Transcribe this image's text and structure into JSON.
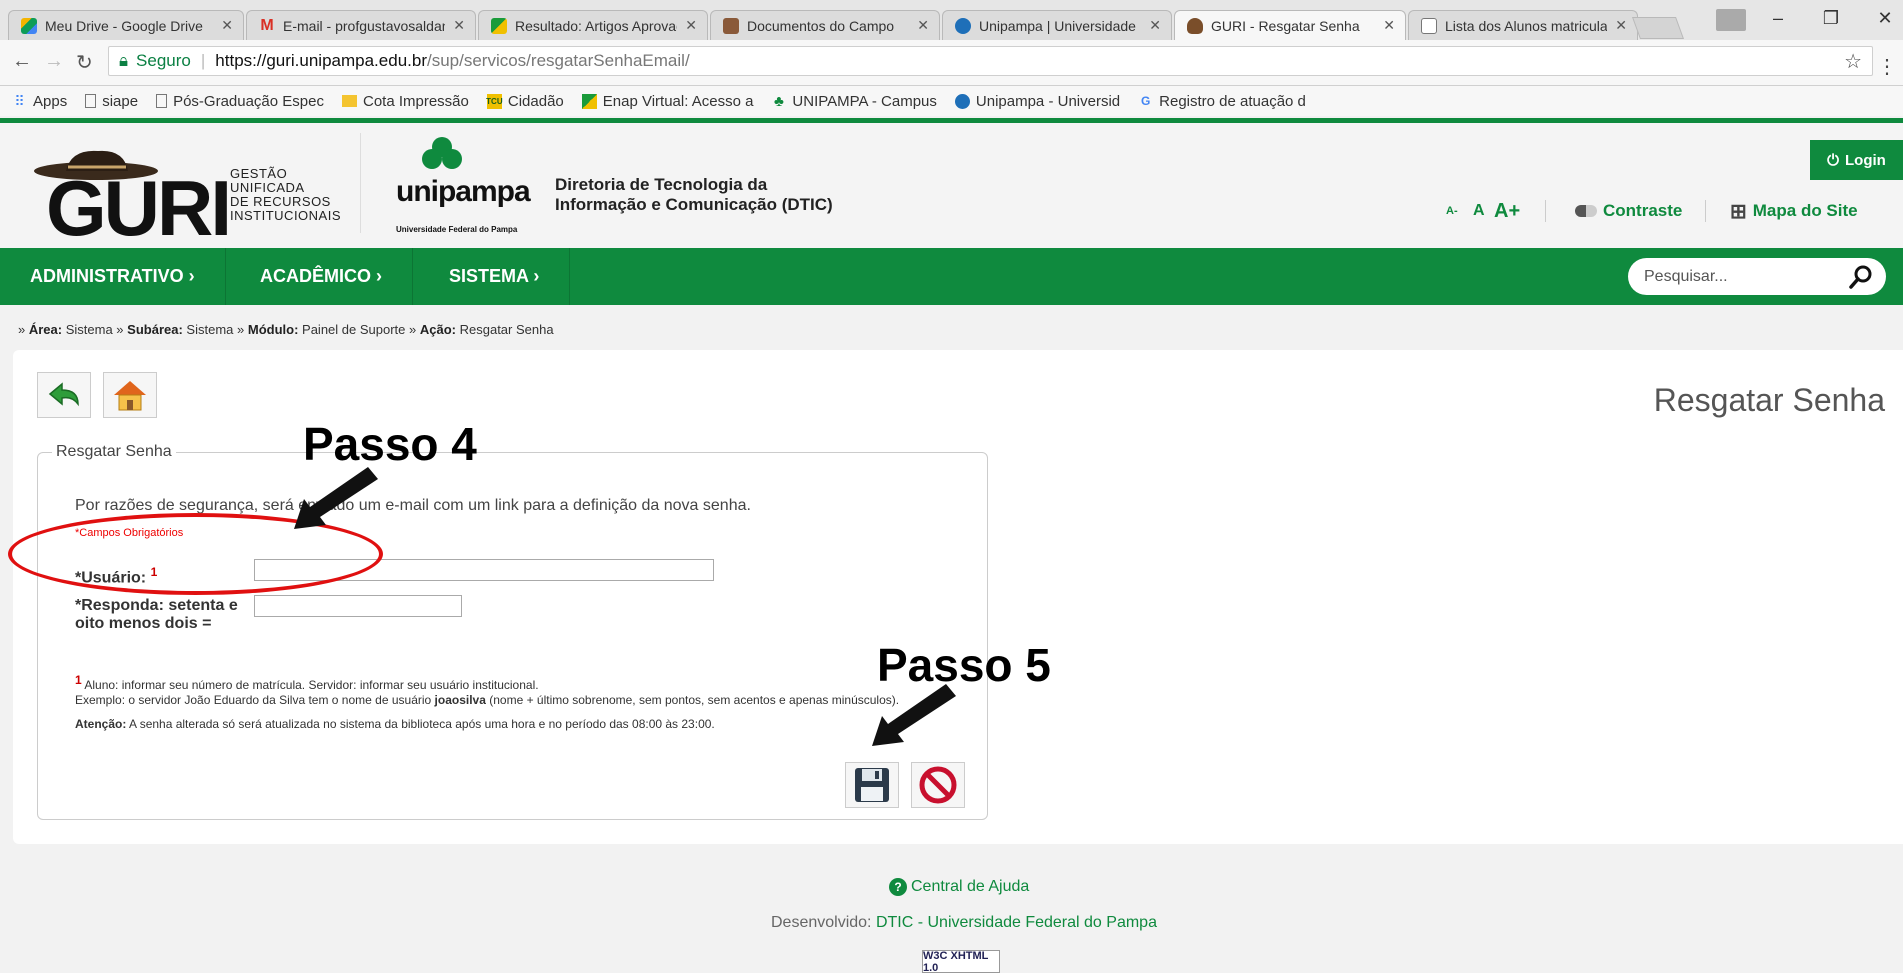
{
  "browser": {
    "tabs": [
      {
        "label": "Meu Drive - Google Drive",
        "icon": "google-drive-icon"
      },
      {
        "label": "E-mail - profgustavosaldanha",
        "icon": "gmail-icon"
      },
      {
        "label": "Resultado: Artigos Aprovados",
        "icon": "enap-icon"
      },
      {
        "label": "Documentos do Campo",
        "icon": "document-icon"
      },
      {
        "label": "Unipampa | Universidade",
        "icon": "unipampa-icon"
      },
      {
        "label": "GURI - Resgatar Senha",
        "icon": "guri-hat-icon"
      },
      {
        "label": "Lista dos Alunos matriculados",
        "icon": "page-icon"
      }
    ],
    "address": {
      "secure_label": "Seguro",
      "url_host": "https://guri.unipampa.edu.br",
      "url_path": "/sup/servicos/resgatarSenhaEmail/"
    },
    "bookmarks": [
      {
        "label": "Apps",
        "icon": "apps-grid-icon"
      },
      {
        "label": "siape",
        "icon": "page-icon"
      },
      {
        "label": "Pós-Graduação Espec",
        "icon": "page-icon"
      },
      {
        "label": "Cota Impressão",
        "icon": "folder-icon"
      },
      {
        "label": "Cidadão",
        "icon": "tcu-icon"
      },
      {
        "label": "Enap Virtual: Acesso a",
        "icon": "enap-icon"
      },
      {
        "label": "UNIPAMPA - Campus",
        "icon": "unipampa-tree-icon"
      },
      {
        "label": "Unipampa - Universid",
        "icon": "unipampa-icon"
      },
      {
        "label": "Registro de atuação d",
        "icon": "google-icon"
      }
    ]
  },
  "header": {
    "logo_word": "GURI",
    "logo_subtitle": [
      "GESTÃO",
      "UNIFICADA",
      "DE RECURSOS",
      "INSTITUCIONAIS"
    ],
    "unipampa_word": "unipampa",
    "unipampa_sub": "Universidade Federal do Pampa",
    "dtic_line1": "Diretoria de Tecnologia da",
    "dtic_line2": "Informação e Comunicação (DTIC)",
    "login_label": "Login",
    "font_small": "A-",
    "font_normal": "A",
    "font_big": "A+",
    "contrast_label": "Contraste",
    "sitemap_label": "Mapa do Site"
  },
  "nav": {
    "items": [
      "ADMINISTRATIVO ›",
      "ACADÊMICO ›",
      "SISTEMA ›"
    ],
    "search_placeholder": "Pesquisar..."
  },
  "breadcrumb": {
    "prefix": "» ",
    "area_label": "Área:",
    "area": "Sistema",
    "subarea_label": "Subárea:",
    "subarea": "Sistema",
    "modulo_label": "Módulo:",
    "modulo": "Painel de Suporte",
    "acao_label": "Ação:",
    "acao": "Resgatar Senha"
  },
  "main": {
    "page_title": "Resgatar Senha",
    "legend": "Resgatar Senha",
    "info": "Por razões de segurança, será enviado um e-mail com um link para a definição da nova senha.",
    "required_note": "*Campos Obrigatórios",
    "usuario_label": "*Usuário:",
    "usuario_sup": "1",
    "usuario_value": "",
    "captcha_label_1": "*Responda: setenta e",
    "captcha_label_2": "oito menos dois =",
    "captcha_value": "",
    "note1_sup": "1",
    "note1": "Aluno: informar seu número de matrícula. Servidor: informar seu usuário institucional.",
    "note2_prefix": "Exemplo: o servidor João Eduardo da Silva tem o nome de usuário ",
    "note2_bold": "joaosilva",
    "note2_suffix": " (nome + último sobrenome, sem pontos, sem acentos e apenas minúsculos).",
    "note3_bold": "Atenção:",
    "note3": " A senha alterada só será atualizada no sistema da biblioteca após uma hora e no período das 08:00 às 23:00."
  },
  "annotations": {
    "step4": "Passo 4",
    "step5": "Passo 5"
  },
  "footer": {
    "help": "Central de Ajuda",
    "dev_prefix": "Desenvolvido:",
    "dev_link": "DTIC - Universidade Federal do Pampa",
    "w3c": "W3C XHTML 1.0"
  },
  "colors": {
    "brand_green": "#0f8a3e",
    "annotation_red": "#e01010"
  }
}
